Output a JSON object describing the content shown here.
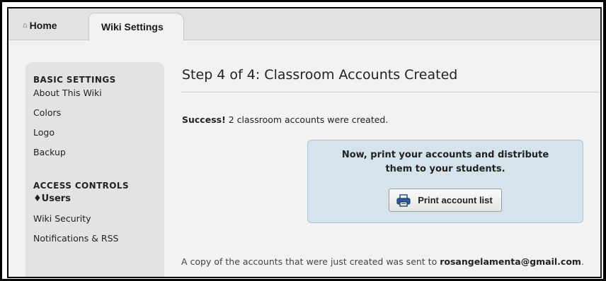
{
  "tabs": {
    "home_icon": "house-icon",
    "home_label": "Home",
    "active_label": "Wiki Settings"
  },
  "sidebar": {
    "basic_heading": "BASIC SETTINGS",
    "basic_items": [
      {
        "label": "About This Wiki"
      },
      {
        "label": "Colors"
      },
      {
        "label": "Logo"
      },
      {
        "label": "Backup"
      }
    ],
    "access_heading": "ACCESS CONTROLS",
    "access_items": [
      {
        "label": "♦Users",
        "active": true
      },
      {
        "label": "Wiki Security"
      },
      {
        "label": "Notifications & RSS"
      }
    ]
  },
  "main": {
    "title": "Step 4 of 4: Classroom Accounts Created",
    "success_bold": "Success!",
    "success_text": " 2 classroom accounts were created.",
    "callout_text": "Now, print your accounts and distribute them to your students.",
    "print_button_label": "Print account list",
    "print_button_icon": "printer-icon",
    "footer_text": "A copy of the accounts that were just created was sent to ",
    "footer_email": "rosangelamenta@gmail.com",
    "footer_end": "."
  },
  "colors": {
    "callout_bg": "#d4e3ec",
    "callout_border": "#a9c5d7",
    "sidebar_bg": "#e3e3e3",
    "page_bg": "#f2f2f2"
  }
}
